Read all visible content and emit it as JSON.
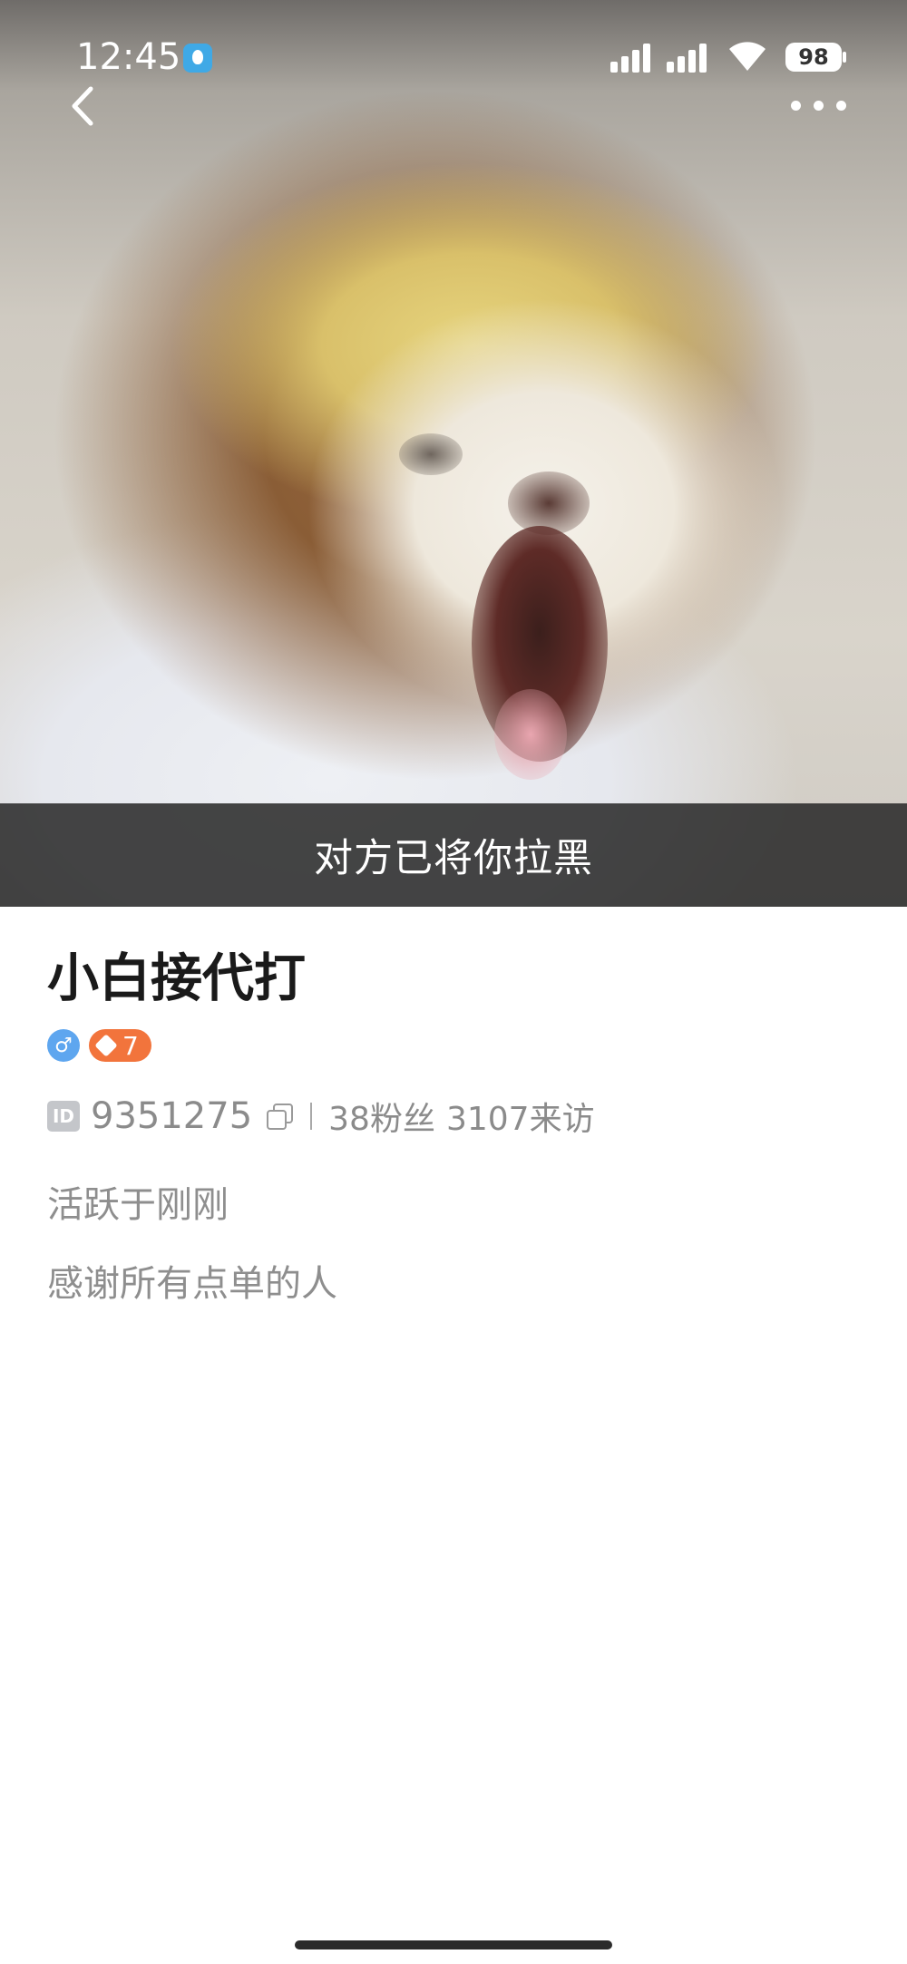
{
  "status_bar": {
    "time": "12:45",
    "battery": "98",
    "icons": [
      "app-notification-icon",
      "signal-icon",
      "signal-icon",
      "wifi-icon",
      "battery-icon"
    ]
  },
  "header": {
    "back_icon": "chevron-left-icon",
    "more_icon": "more-dots-icon"
  },
  "cover": {
    "blocked_notice": "对方已将你拉黑"
  },
  "profile": {
    "nickname": "小白接代打",
    "gender_symbol": "♂",
    "level": "7",
    "id_label": "ID",
    "user_id": "9351275",
    "fans": "38粉丝",
    "visits": "3107来访",
    "active_status": "活跃于刚刚",
    "bio": "感谢所有点单的人"
  },
  "colors": {
    "gender_badge": "#5ea6ef",
    "level_badge": "#f2743c",
    "banner": "#282828",
    "secondary_text": "#8b8b8b"
  }
}
